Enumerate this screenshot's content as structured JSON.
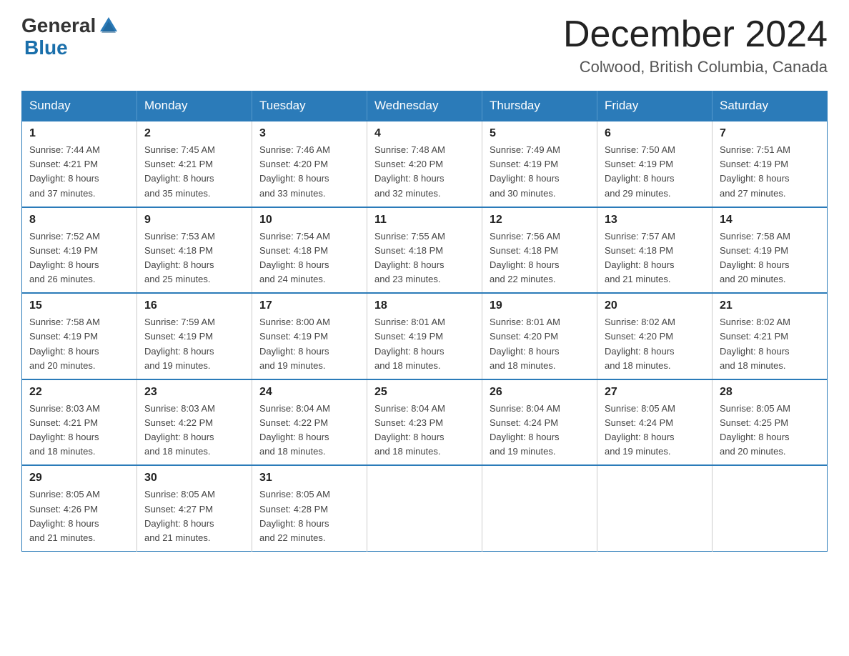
{
  "header": {
    "logo_general": "General",
    "logo_blue": "Blue",
    "title": "December 2024",
    "subtitle": "Colwood, British Columbia, Canada"
  },
  "calendar": {
    "days_of_week": [
      "Sunday",
      "Monday",
      "Tuesday",
      "Wednesday",
      "Thursday",
      "Friday",
      "Saturday"
    ],
    "weeks": [
      [
        {
          "day": "1",
          "sunrise": "7:44 AM",
          "sunset": "4:21 PM",
          "daylight": "8 hours and 37 minutes."
        },
        {
          "day": "2",
          "sunrise": "7:45 AM",
          "sunset": "4:21 PM",
          "daylight": "8 hours and 35 minutes."
        },
        {
          "day": "3",
          "sunrise": "7:46 AM",
          "sunset": "4:20 PM",
          "daylight": "8 hours and 33 minutes."
        },
        {
          "day": "4",
          "sunrise": "7:48 AM",
          "sunset": "4:20 PM",
          "daylight": "8 hours and 32 minutes."
        },
        {
          "day": "5",
          "sunrise": "7:49 AM",
          "sunset": "4:19 PM",
          "daylight": "8 hours and 30 minutes."
        },
        {
          "day": "6",
          "sunrise": "7:50 AM",
          "sunset": "4:19 PM",
          "daylight": "8 hours and 29 minutes."
        },
        {
          "day": "7",
          "sunrise": "7:51 AM",
          "sunset": "4:19 PM",
          "daylight": "8 hours and 27 minutes."
        }
      ],
      [
        {
          "day": "8",
          "sunrise": "7:52 AM",
          "sunset": "4:19 PM",
          "daylight": "8 hours and 26 minutes."
        },
        {
          "day": "9",
          "sunrise": "7:53 AM",
          "sunset": "4:18 PM",
          "daylight": "8 hours and 25 minutes."
        },
        {
          "day": "10",
          "sunrise": "7:54 AM",
          "sunset": "4:18 PM",
          "daylight": "8 hours and 24 minutes."
        },
        {
          "day": "11",
          "sunrise": "7:55 AM",
          "sunset": "4:18 PM",
          "daylight": "8 hours and 23 minutes."
        },
        {
          "day": "12",
          "sunrise": "7:56 AM",
          "sunset": "4:18 PM",
          "daylight": "8 hours and 22 minutes."
        },
        {
          "day": "13",
          "sunrise": "7:57 AM",
          "sunset": "4:18 PM",
          "daylight": "8 hours and 21 minutes."
        },
        {
          "day": "14",
          "sunrise": "7:58 AM",
          "sunset": "4:19 PM",
          "daylight": "8 hours and 20 minutes."
        }
      ],
      [
        {
          "day": "15",
          "sunrise": "7:58 AM",
          "sunset": "4:19 PM",
          "daylight": "8 hours and 20 minutes."
        },
        {
          "day": "16",
          "sunrise": "7:59 AM",
          "sunset": "4:19 PM",
          "daylight": "8 hours and 19 minutes."
        },
        {
          "day": "17",
          "sunrise": "8:00 AM",
          "sunset": "4:19 PM",
          "daylight": "8 hours and 19 minutes."
        },
        {
          "day": "18",
          "sunrise": "8:01 AM",
          "sunset": "4:19 PM",
          "daylight": "8 hours and 18 minutes."
        },
        {
          "day": "19",
          "sunrise": "8:01 AM",
          "sunset": "4:20 PM",
          "daylight": "8 hours and 18 minutes."
        },
        {
          "day": "20",
          "sunrise": "8:02 AM",
          "sunset": "4:20 PM",
          "daylight": "8 hours and 18 minutes."
        },
        {
          "day": "21",
          "sunrise": "8:02 AM",
          "sunset": "4:21 PM",
          "daylight": "8 hours and 18 minutes."
        }
      ],
      [
        {
          "day": "22",
          "sunrise": "8:03 AM",
          "sunset": "4:21 PM",
          "daylight": "8 hours and 18 minutes."
        },
        {
          "day": "23",
          "sunrise": "8:03 AM",
          "sunset": "4:22 PM",
          "daylight": "8 hours and 18 minutes."
        },
        {
          "day": "24",
          "sunrise": "8:04 AM",
          "sunset": "4:22 PM",
          "daylight": "8 hours and 18 minutes."
        },
        {
          "day": "25",
          "sunrise": "8:04 AM",
          "sunset": "4:23 PM",
          "daylight": "8 hours and 18 minutes."
        },
        {
          "day": "26",
          "sunrise": "8:04 AM",
          "sunset": "4:24 PM",
          "daylight": "8 hours and 19 minutes."
        },
        {
          "day": "27",
          "sunrise": "8:05 AM",
          "sunset": "4:24 PM",
          "daylight": "8 hours and 19 minutes."
        },
        {
          "day": "28",
          "sunrise": "8:05 AM",
          "sunset": "4:25 PM",
          "daylight": "8 hours and 20 minutes."
        }
      ],
      [
        {
          "day": "29",
          "sunrise": "8:05 AM",
          "sunset": "4:26 PM",
          "daylight": "8 hours and 21 minutes."
        },
        {
          "day": "30",
          "sunrise": "8:05 AM",
          "sunset": "4:27 PM",
          "daylight": "8 hours and 21 minutes."
        },
        {
          "day": "31",
          "sunrise": "8:05 AM",
          "sunset": "4:28 PM",
          "daylight": "8 hours and 22 minutes."
        },
        null,
        null,
        null,
        null
      ]
    ]
  }
}
